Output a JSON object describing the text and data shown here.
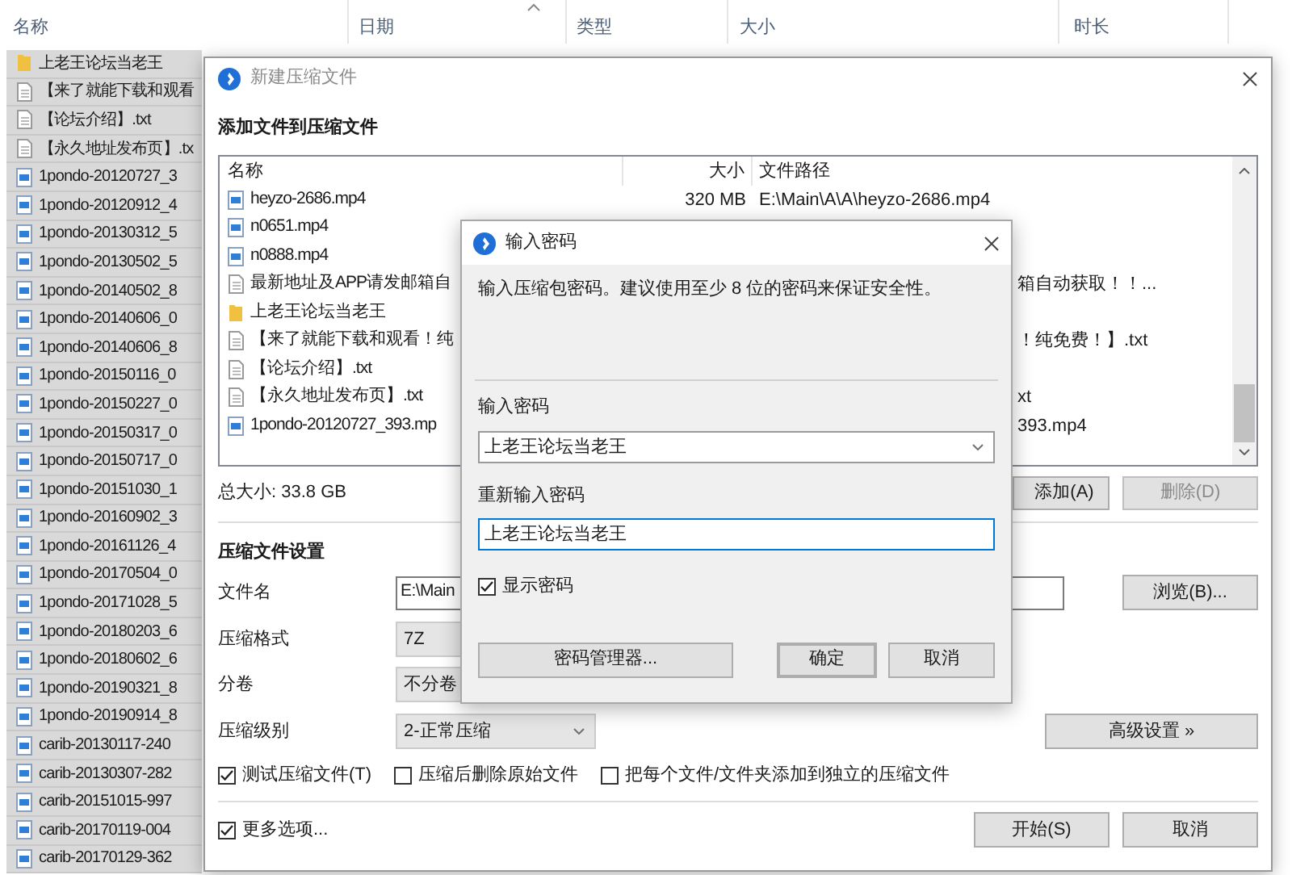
{
  "explorer": {
    "columns": [
      "名称",
      "日期",
      "类型",
      "大小",
      "时长"
    ],
    "rows": [
      {
        "name": "上老王论坛当老王",
        "kind": "folder",
        "selected": true
      },
      {
        "name": "【来了就能下载和观看",
        "kind": "text",
        "selected": true
      },
      {
        "name": "【论坛介绍】.txt",
        "kind": "text",
        "selected": true
      },
      {
        "name": "【永久地址发布页】.tx",
        "kind": "text",
        "selected": true
      },
      {
        "name": "1pondo-20120727_3",
        "kind": "video",
        "selected": true
      },
      {
        "name": "1pondo-20120912_4",
        "kind": "video",
        "selected": true
      },
      {
        "name": "1pondo-20130312_5",
        "kind": "video",
        "selected": true
      },
      {
        "name": "1pondo-20130502_5",
        "kind": "video",
        "selected": true
      },
      {
        "name": "1pondo-20140502_8",
        "kind": "video",
        "selected": true
      },
      {
        "name": "1pondo-20140606_0",
        "kind": "video",
        "selected": true
      },
      {
        "name": "1pondo-20140606_8",
        "kind": "video",
        "selected": true
      },
      {
        "name": "1pondo-20150116_0",
        "kind": "video",
        "selected": true
      },
      {
        "name": "1pondo-20150227_0",
        "kind": "video",
        "selected": true
      },
      {
        "name": "1pondo-20150317_0",
        "kind": "video",
        "selected": true
      },
      {
        "name": "1pondo-20150717_0",
        "kind": "video",
        "selected": true
      },
      {
        "name": "1pondo-20151030_1",
        "kind": "video",
        "selected": true
      },
      {
        "name": "1pondo-20160902_3",
        "kind": "video",
        "selected": true
      },
      {
        "name": "1pondo-20161126_4",
        "kind": "video",
        "selected": true
      },
      {
        "name": "1pondo-20170504_0",
        "kind": "video",
        "selected": true
      },
      {
        "name": "1pondo-20171028_5",
        "kind": "video",
        "selected": true
      },
      {
        "name": "1pondo-20180203_6",
        "kind": "video",
        "selected": true
      },
      {
        "name": "1pondo-20180602_6",
        "kind": "video",
        "selected": true
      },
      {
        "name": "1pondo-20190321_8",
        "kind": "video",
        "selected": true
      },
      {
        "name": "1pondo-20190914_8",
        "kind": "video",
        "selected": true
      },
      {
        "name": "carib-20130117-240",
        "kind": "video",
        "selected": true
      },
      {
        "name": "carib-20130307-282",
        "kind": "video",
        "selected": true
      },
      {
        "name": "carib-20151015-997",
        "kind": "video",
        "selected": true
      },
      {
        "name": "carib-20170119-004",
        "kind": "video",
        "selected": true
      },
      {
        "name": "carib-20170129-362",
        "kind": "video",
        "selected": true
      }
    ]
  },
  "compress_dialog": {
    "title": "新建压缩文件",
    "section_title": "添加文件到压缩文件",
    "file_list": {
      "columns": [
        "名称",
        "大小",
        "文件路径"
      ],
      "rows": [
        {
          "name": "heyzo-2686.mp4",
          "kind": "video",
          "size": "320 MB",
          "path": "E:\\Main\\A\\A\\heyzo-2686.mp4",
          "path_clip": false
        },
        {
          "name": "n0651.mp4",
          "kind": "video"
        },
        {
          "name": "n0888.mp4",
          "kind": "video"
        },
        {
          "name": "最新地址及APP请发邮箱自",
          "kind": "text",
          "path": "箱自动获取！！...",
          "path_clip": true
        },
        {
          "name": "上老王论坛当老王",
          "kind": "folder"
        },
        {
          "name": "【来了就能下载和观看！纯",
          "kind": "text",
          "path": "！纯免费！】.txt",
          "path_clip": true
        },
        {
          "name": "【论坛介绍】.txt",
          "kind": "text"
        },
        {
          "name": "【永久地址发布页】.txt",
          "kind": "text",
          "path": "xt",
          "path_clip": true
        },
        {
          "name": "1pondo-20120727_393.mp",
          "kind": "video",
          "path": "393.mp4",
          "path_clip": true
        }
      ]
    },
    "total_size": "总大小: 33.8 GB",
    "add_button": "添加(A)",
    "delete_button": {
      "label": "删除(D)",
      "disabled": true
    },
    "settings_title": "压缩文件设置",
    "fields": [
      {
        "label": "文件名",
        "kind": "text",
        "value": "E:\\Main"
      },
      {
        "label": "压缩格式",
        "kind": "covered-select",
        "value": "7Z"
      },
      {
        "label": "分卷",
        "kind": "covered-select",
        "value": "不分卷"
      },
      {
        "label": "压缩级别",
        "kind": "select",
        "value": "2-正常压缩"
      }
    ],
    "browse_button": "浏览(B)...",
    "advanced_button": "高级设置 »",
    "options": [
      {
        "label": "测试压缩文件(T)",
        "checked": true
      },
      {
        "label": "压缩后删除原始文件",
        "checked": false
      },
      {
        "label": "把每个文件/文件夹添加到独立的压缩文件",
        "checked": false
      }
    ],
    "more_options": {
      "label": "更多选项...",
      "checked": true
    },
    "buttons": [
      "开始(S)",
      "取消"
    ]
  },
  "password_dialog": {
    "title": "输入密码",
    "description": "输入压缩包密码。建议使用至少 8 位的密码来保证安全性。",
    "password_label": "输入密码",
    "password_value": "上老王论坛当老王",
    "confirm_label": "重新输入密码",
    "confirm_value": "上老王论坛当老王",
    "show_password": {
      "label": "显示密码",
      "checked": true
    },
    "buttons": [
      {
        "label": "密码管理器...",
        "default": false
      },
      {
        "label": "确定",
        "default": true
      },
      {
        "label": "取消",
        "default": false
      }
    ]
  }
}
